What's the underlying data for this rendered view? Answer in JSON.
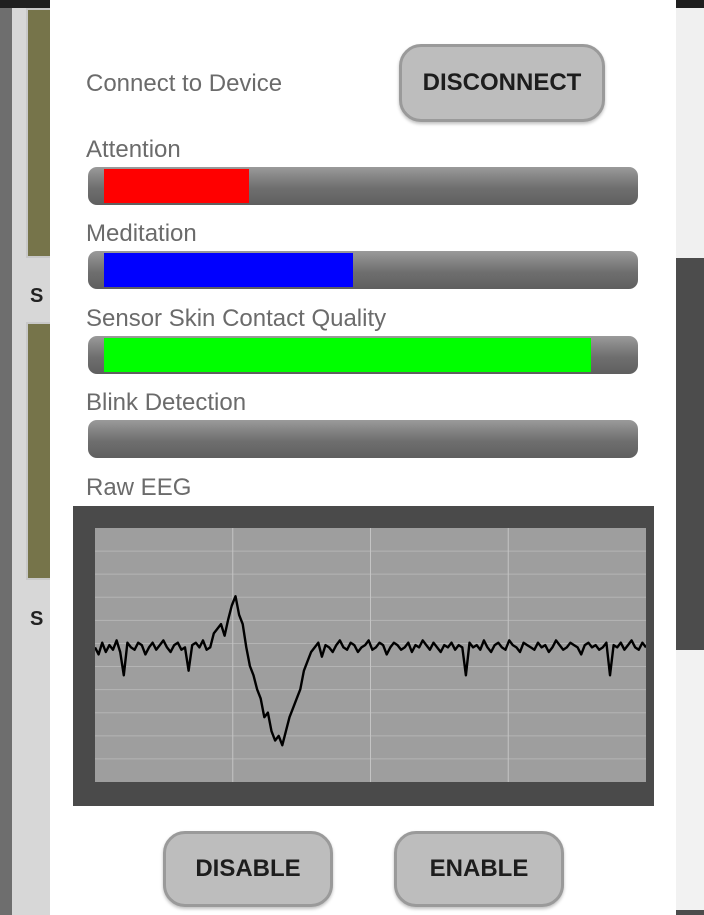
{
  "background": {
    "label_a": "S",
    "label_b": "S"
  },
  "dialog": {
    "connect_label": "Connect to Device",
    "disconnect_button": "DISCONNECT",
    "attention": {
      "label": "Attention",
      "level": 0.28,
      "color": "#ff0000"
    },
    "meditation": {
      "label": "Meditation",
      "level": 0.48,
      "color": "#0000ff"
    },
    "sensor_quality": {
      "label": "Sensor Skin Contact Quality",
      "level": 0.94,
      "color": "#00ff00"
    },
    "blink": {
      "label": "Blink Detection",
      "level": 0.0,
      "color": "#ffff00"
    },
    "raw_eeg": {
      "label": "Raw EEG",
      "series": [
        0,
        -3,
        2,
        -2,
        1,
        -1,
        3,
        -2,
        -12,
        2,
        0,
        -1,
        2,
        1,
        -3,
        0,
        2,
        -1,
        1,
        3,
        0,
        -2,
        1,
        2,
        -1,
        0,
        -10,
        1,
        2,
        0,
        3,
        -1,
        0,
        6,
        8,
        10,
        5,
        12,
        18,
        22,
        14,
        10,
        0,
        -8,
        -12,
        -18,
        -22,
        -30,
        -28,
        -36,
        -40,
        -38,
        -42,
        -36,
        -30,
        -26,
        -22,
        -18,
        -10,
        -6,
        -2,
        0,
        2,
        -4,
        1,
        0,
        -2,
        1,
        3,
        0,
        -1,
        2,
        1,
        -2,
        0,
        1,
        3,
        -1,
        0,
        2,
        1,
        -3,
        0,
        2,
        1,
        -1,
        0,
        2,
        -2,
        1,
        0,
        3,
        1,
        -1,
        2,
        0,
        -2,
        1,
        0,
        2,
        -1,
        1,
        0,
        -12,
        2,
        0,
        1,
        -1,
        3,
        0,
        -2,
        1,
        2,
        0,
        -1,
        3,
        1,
        0,
        -2,
        2,
        1,
        0,
        -1,
        2,
        0,
        1,
        -2,
        0,
        3,
        1,
        -1,
        0,
        2,
        1,
        0,
        -3,
        1,
        2,
        0,
        1,
        -1,
        0,
        2,
        -12,
        1,
        0,
        2,
        -1,
        1,
        3,
        0,
        -1,
        2,
        0
      ],
      "ymin": -60,
      "ymax": 60
    },
    "disable_button": "DISABLE",
    "enable_button": "ENABLE"
  }
}
